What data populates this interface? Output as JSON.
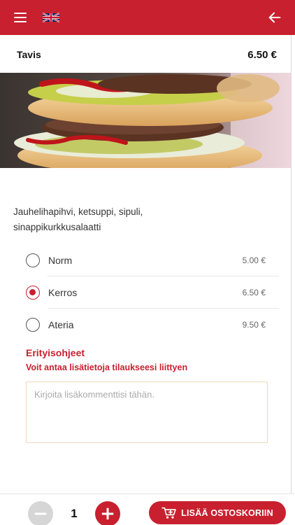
{
  "header": {
    "menu_icon": "hamburger-menu-icon",
    "language_icon": "uk-flag-icon",
    "back_icon": "arrow-left-icon",
    "color": "#c8202f"
  },
  "product": {
    "name": "Tavis",
    "price": "6.50 €",
    "image": "burger-photo",
    "description": "Jauhelihapihvi, ketsuppi, sipuli, sinappikurkkusalaatti"
  },
  "options": [
    {
      "label": "Norm",
      "price": "5.00 €",
      "selected": false
    },
    {
      "label": "Kerros",
      "price": "6.50 €",
      "selected": true
    },
    {
      "label": "Ateria",
      "price": "9.50 €",
      "selected": false
    }
  ],
  "special": {
    "title": "Erityisohjeet",
    "subtitle": "Voit antaa lisätietoja tilaukseesi liittyen",
    "placeholder": "Kirjoita lisäkommenttisi tähän.",
    "value": ""
  },
  "footer": {
    "minus_icon": "minus-icon",
    "plus_icon": "plus-icon",
    "quantity": "1",
    "add_to_cart_icon": "cart-plus-icon",
    "add_to_cart_label": "LISÄÄ OSTOSKORIIN"
  }
}
